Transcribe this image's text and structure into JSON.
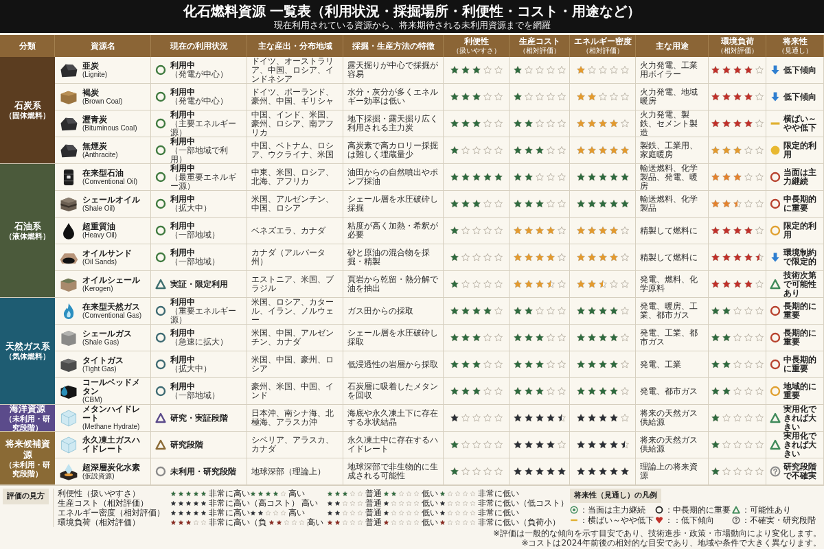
{
  "title": "化石燃料資源 一覧表（利用状況・採掘場所・利便性・コスト・用途など）",
  "subtitle": "現在利用されている資源から、将来期待される未利用資源までを網羅",
  "columns": [
    {
      "label": "分類"
    },
    {
      "label": "資源名"
    },
    {
      "label": "現在の利用状況"
    },
    {
      "label": "主な産出・分布地域"
    },
    {
      "label": "採掘・生産方法の特徴"
    },
    {
      "label": "利便性",
      "sub": "（扱いやすさ）"
    },
    {
      "label": "生産コスト",
      "sub": "（相対評価）"
    },
    {
      "label": "エネルギー密度",
      "sub": "（相対評価）"
    },
    {
      "label": "主な用途"
    },
    {
      "label": "環境負荷",
      "sub": "（相対評価）"
    },
    {
      "label": "将来性",
      "sub": "（見通し）"
    }
  ],
  "groups": [
    {
      "label": "石炭系",
      "sub": "（固体燃料）",
      "color": "#5b3d20",
      "rows": [
        {
          "name": "亜炭",
          "name_sub": "(Lignite)",
          "status": {
            "kind": "circle",
            "color": "#3f7a3f",
            "text": "利用中",
            "sub": "（発電が中心）"
          },
          "regions": "ドイツ、オーストラリア、中国、ロシア、インドネシア",
          "method": "露天掘りが中心で採掘が容易",
          "convenience": {
            "stars": 3,
            "color": "#2f6b3f"
          },
          "cost": {
            "stars": 1,
            "color": "#2f6b3f"
          },
          "density": {
            "stars": 1,
            "color": "#e39a2e"
          },
          "uses": "火力発電、工業用ボイラー",
          "environment": {
            "stars": 4,
            "color": "#c0302a"
          },
          "outlook": {
            "kind": "down",
            "color": "#2f7fd0",
            "text": "低下傾向"
          }
        },
        {
          "name": "褐炭",
          "name_sub": "(Brown Coal)",
          "status": {
            "kind": "circle",
            "color": "#3f7a3f",
            "text": "利用中",
            "sub": "（発電が中心）"
          },
          "regions": "ドイツ、ポーランド、豪州、中国、ギリシャ",
          "method": "水分・灰分が多くエネルギー効率は低い",
          "convenience": {
            "stars": 3,
            "color": "#2f6b3f"
          },
          "cost": {
            "stars": 1,
            "color": "#2f6b3f"
          },
          "density": {
            "stars": 2,
            "color": "#e39a2e"
          },
          "uses": "火力発電、地域暖房",
          "environment": {
            "stars": 4,
            "color": "#c0302a"
          },
          "outlook": {
            "kind": "down",
            "color": "#2f7fd0",
            "text": "低下傾向"
          }
        },
        {
          "name": "瀝青炭",
          "name_sub": "(Bituminous Coal)",
          "status": {
            "kind": "circle",
            "color": "#3f7a3f",
            "text": "利用中",
            "sub": "（主要エネルギー源）"
          },
          "regions": "中国、インド、米国、豪州、ロシア、南アフリカ",
          "method": "地下採掘・露天掘り広く利用される主力炭",
          "convenience": {
            "stars": 3,
            "color": "#2f6b3f"
          },
          "cost": {
            "stars": 2,
            "color": "#2f6b3f"
          },
          "density": {
            "stars": 4,
            "color": "#e39a2e"
          },
          "uses": "火力発電、製鉄、セメント製造",
          "environment": {
            "stars": 4,
            "color": "#c0302a"
          },
          "outlook": {
            "kind": "dash",
            "color": "#e0b030",
            "text": "横ばい～やや低下"
          }
        },
        {
          "name": "無煙炭",
          "name_sub": "(Anthracite)",
          "status": {
            "kind": "circle",
            "color": "#3f7a3f",
            "text": "利用中",
            "sub": "（一部地域で利用）"
          },
          "regions": "中国、ベトナム、ロシア、ウクライナ、米国",
          "method": "高炭素で高カロリー採掘は難しく埋蔵量少",
          "convenience": {
            "stars": 1,
            "color": "#2f6b3f"
          },
          "cost": {
            "stars": 3,
            "color": "#2f6b3f"
          },
          "density": {
            "stars": 5,
            "color": "#e39a2e"
          },
          "uses": "製鉄、工業用、家庭暖房",
          "environment": {
            "stars": 3,
            "color": "#e39a2e"
          },
          "outlook": {
            "kind": "dot",
            "color": "#e8b830",
            "text": "限定的利用"
          }
        }
      ]
    },
    {
      "label": "石油系",
      "sub": "（液体燃料）",
      "color": "#4b5a3b",
      "rows": [
        {
          "name": "在来型石油",
          "name_sub": "(Conventional Oil)",
          "status": {
            "kind": "circle",
            "color": "#3f7a3f",
            "text": "利用中",
            "sub": "（最重要エネルギー源）"
          },
          "regions": "中東、米国、ロシア、北海、アフリカ",
          "method": "油田からの自然噴出やポンプ採油",
          "convenience": {
            "stars": 5,
            "color": "#2f6b3f"
          },
          "cost": {
            "stars": 2,
            "color": "#2f6b3f"
          },
          "density": {
            "stars": 5,
            "color": "#2f6b3f"
          },
          "uses": "輸送燃料、化学製品、発電、暖房",
          "environment": {
            "stars": 3,
            "color": "#e3822e"
          },
          "outlook": {
            "kind": "circle",
            "color": "#b8432f",
            "text": "当面は主力継続"
          }
        },
        {
          "name": "シェールオイル",
          "name_sub": "(Shale Oil)",
          "status": {
            "kind": "circle",
            "color": "#3f7a3f",
            "text": "利用中",
            "sub": "（拡大中）"
          },
          "regions": "米国、アルゼンチン、中国、ロシア",
          "method": "シェール層を水圧破砕し採掘",
          "convenience": {
            "stars": 3,
            "color": "#2f6b3f"
          },
          "cost": {
            "stars": 3,
            "color": "#2f6b3f"
          },
          "density": {
            "stars": 5,
            "color": "#2f6b3f"
          },
          "uses": "輸送燃料、化学製品",
          "environment": {
            "stars": 2.5,
            "color": "#e3822e"
          },
          "outlook": {
            "kind": "circle",
            "color": "#b8432f",
            "text": "中長期的に重要"
          }
        },
        {
          "name": "超重質油",
          "name_sub": "(Heavy Oil)",
          "status": {
            "kind": "circle",
            "color": "#3f7a3f",
            "text": "利用中",
            "sub": "（一部地域）"
          },
          "regions": "ベネズエラ、カナダ",
          "method": "粘度が高く加熱・希釈が必要",
          "convenience": {
            "stars": 1,
            "color": "#2f6b3f"
          },
          "cost": {
            "stars": 4,
            "color": "#e39a2e"
          },
          "density": {
            "stars": 4,
            "color": "#e39a2e"
          },
          "uses": "精製して燃料に",
          "environment": {
            "stars": 4,
            "color": "#c0302a"
          },
          "outlook": {
            "kind": "circle",
            "color": "#e0a030",
            "text": "限定的利用"
          }
        },
        {
          "name": "オイルサンド",
          "name_sub": "(Oil Sands)",
          "status": {
            "kind": "circle",
            "color": "#3f7a3f",
            "text": "利用中",
            "sub": "（一部地域）"
          },
          "regions": "カナダ（アルバータ州）",
          "method": "砂と原油の混合物を採掘・精製",
          "convenience": {
            "stars": 1,
            "color": "#2f6b3f"
          },
          "cost": {
            "stars": 4,
            "color": "#e39a2e"
          },
          "density": {
            "stars": 4,
            "color": "#e39a2e"
          },
          "uses": "精製して燃料に",
          "environment": {
            "stars": 4.5,
            "color": "#c0302a"
          },
          "outlook": {
            "kind": "down",
            "color": "#2f7fd0",
            "text": "環境制約で限定的"
          }
        },
        {
          "name": "オイルシェール",
          "name_sub": "(Kerogen)",
          "status": {
            "kind": "triangle",
            "color": "#3f6f6f",
            "text": "実証・限定利用"
          },
          "regions": "エストニア、米国、ブラジル",
          "method": "頁岩から乾留・熱分解で油を抽出",
          "convenience": {
            "stars": 1,
            "color": "#2f6b3f"
          },
          "cost": {
            "stars": 3.5,
            "color": "#e39a2e"
          },
          "density": {
            "stars": 2.5,
            "color": "#e39a2e"
          },
          "uses": "発電、燃料、化学原料",
          "environment": {
            "stars": 4,
            "color": "#c0302a"
          },
          "outlook": {
            "kind": "triangle",
            "color": "#3f8a5a",
            "text": "技術次第で可能性あり"
          }
        }
      ]
    },
    {
      "label": "天然ガス系",
      "sub": "（気体燃料）",
      "color": "#1e5c72",
      "rows": [
        {
          "name": "在来型天然ガス",
          "name_sub": "(Conventional Gas)",
          "status": {
            "kind": "circle",
            "color": "#3d6a72",
            "text": "利用中",
            "sub": "（重要エネルギー源）"
          },
          "regions": "米国、ロシア、カタール、イラン、ノルウェー",
          "method": "ガス田からの採取",
          "convenience": {
            "stars": 4,
            "color": "#2f6b3f"
          },
          "cost": {
            "stars": 2,
            "color": "#2f6b3f"
          },
          "density": {
            "stars": 4,
            "color": "#2f6b3f"
          },
          "uses": "発電、暖房、工業、都市ガス",
          "environment": {
            "stars": 2,
            "color": "#2f6b3f"
          },
          "outlook": {
            "kind": "circle",
            "color": "#b8432f",
            "text": "長期的に重要"
          }
        },
        {
          "name": "シェールガス",
          "name_sub": "(Shale Gas)",
          "status": {
            "kind": "circle",
            "color": "#3d6a72",
            "text": "利用中",
            "sub": "（急速に拡大）"
          },
          "regions": "米国、中国、アルゼンチン、カナダ",
          "method": "シェール層を水圧破砕し採取",
          "convenience": {
            "stars": 3,
            "color": "#2f6b3f"
          },
          "cost": {
            "stars": 3,
            "color": "#2f6b3f"
          },
          "density": {
            "stars": 4,
            "color": "#2f6b3f"
          },
          "uses": "発電、工業、都市ガス",
          "environment": {
            "stars": 2,
            "color": "#2f6b3f"
          },
          "outlook": {
            "kind": "circle",
            "color": "#b8432f",
            "text": "長期的に重要"
          }
        },
        {
          "name": "タイトガス",
          "name_sub": "(Tight Gas)",
          "status": {
            "kind": "circle",
            "color": "#3d6a72",
            "text": "利用中",
            "sub": "（拡大中）"
          },
          "regions": "米国、中国、豪州、ロシア",
          "method": "低浸透性の岩層から採取",
          "convenience": {
            "stars": 3,
            "color": "#2f6b3f"
          },
          "cost": {
            "stars": 3,
            "color": "#2f6b3f"
          },
          "density": {
            "stars": 4,
            "color": "#2f6b3f"
          },
          "uses": "発電、工業",
          "environment": {
            "stars": 2,
            "color": "#2f6b3f"
          },
          "outlook": {
            "kind": "circle",
            "color": "#b8432f",
            "text": "中長期的に重要"
          }
        },
        {
          "name": "コールベッドメタン",
          "name_sub": "(CBM)",
          "status": {
            "kind": "circle",
            "color": "#3d6a72",
            "text": "利用中",
            "sub": "（一部地域）"
          },
          "regions": "豪州、米国、中国、インド",
          "method": "石炭層に吸着したメタンを回収",
          "convenience": {
            "stars": 3,
            "color": "#2f6b3f"
          },
          "cost": {
            "stars": 3,
            "color": "#2f6b3f"
          },
          "density": {
            "stars": 4,
            "color": "#2f6b3f"
          },
          "uses": "発電、都市ガス",
          "environment": {
            "stars": 2,
            "color": "#2f6b3f"
          },
          "outlook": {
            "kind": "circle",
            "color": "#e0a030",
            "text": "地域的に重要"
          }
        }
      ]
    },
    {
      "label": "海洋資源",
      "sub": "（未利用・研究段階）",
      "color": "#5b4b8b",
      "rows": [
        {
          "name": "メタンハイドレート",
          "name_sub": "(Methane Hydrate)",
          "status": {
            "kind": "triangle",
            "color": "#5a4a8a",
            "text": "研究・実証段階"
          },
          "regions": "日本沖、南シナ海、北極海、アラスカ沖",
          "method": "海底や永久凍土下に存在する氷状結晶",
          "convenience": {
            "stars": 1,
            "color": "#2b2f36"
          },
          "cost": {
            "stars": 4.5,
            "color": "#2b2f36"
          },
          "density": {
            "stars": 4,
            "color": "#2b2f36"
          },
          "uses": "将来の天然ガス供給源",
          "environment": {
            "stars": 1,
            "color": "#2f6b3f"
          },
          "outlook": {
            "kind": "triangle",
            "color": "#3f8a5a",
            "text": "実用化できれば大きい"
          }
        }
      ]
    },
    {
      "label": "将来候補資源",
      "sub": "（未利用・研究段階）",
      "color": "#8a6a35",
      "rows": [
        {
          "name": "永久凍土ガスハイドレート",
          "status": {
            "kind": "triangle",
            "color": "#8a6a35",
            "text": "研究段階"
          },
          "regions": "シベリア、アラスカ、カナダ",
          "method": "永久凍土中に存在するハイドレート",
          "convenience": {
            "stars": 1,
            "color": "#2f6b3f"
          },
          "cost": {
            "stars": 4,
            "color": "#2b2f36"
          },
          "density": {
            "stars": 4.5,
            "color": "#2b2f36"
          },
          "uses": "将来の天然ガス供給源",
          "environment": {
            "stars": 1,
            "color": "#2f6b3f"
          },
          "outlook": {
            "kind": "triangle",
            "color": "#3f8a5a",
            "text": "実用化できれば大きい"
          }
        },
        {
          "name": "超深層炭化水素",
          "name_sub": "(仮説資源)",
          "status": {
            "kind": "circle",
            "color": "#8a8a8a",
            "text": "未利用・研究段階"
          },
          "regions": "地球深部（理論上）",
          "method": "地球深部で非生物的に生成される可能性",
          "convenience": {
            "stars": 1,
            "color": "#2f6b3f"
          },
          "cost": {
            "stars": 5,
            "color": "#2b2f36"
          },
          "density": {
            "stars": 5,
            "color": "#2b2f36"
          },
          "uses": "理論上の将来資源",
          "environment": {
            "stars": 1,
            "color": "#2f6b3f"
          },
          "outlook": {
            "kind": "question",
            "color": "#8a8a8a",
            "text": "研究段階で不確実"
          }
        }
      ]
    }
  ],
  "rating_legend": {
    "title": "評価の見方",
    "rows": [
      {
        "label": "利便性（扱いやすさ）",
        "color": "#2f6b3f",
        "entries": [
          {
            "stars": 5,
            "text": "非常に高い"
          },
          {
            "stars": 4,
            "text": "高い"
          },
          {
            "stars": 3,
            "text": "普通"
          },
          {
            "stars": 2,
            "text": "低い"
          },
          {
            "stars": 1,
            "text": "非常に低い"
          }
        ]
      },
      {
        "label": "生産コスト（相対評価）",
        "color": "#2b2f36",
        "entries": [
          {
            "stars": 5,
            "text": "非常に高い"
          },
          {
            "note": "（高コスト）",
            "text": "高い"
          },
          {
            "stars": 2,
            "text": "普通"
          },
          {
            "stars": 1,
            "text": "低い"
          },
          {
            "stars": 1,
            "text": "非常に低い（低コスト）"
          }
        ]
      },
      {
        "label": "エネルギー密度（相対評価）",
        "color": "#2b2f36",
        "entries": [
          {
            "stars": 5,
            "text": "非常に高い"
          },
          {
            "stars": 2,
            "text": "高い"
          },
          {
            "stars": 2,
            "text": "普通"
          },
          {
            "stars": 1,
            "text": "低い"
          },
          {
            "stars": 1,
            "text": "非常に低い"
          }
        ]
      },
      {
        "label": "環境負荷（相対評価）",
        "color": "#8a2a22",
        "entries": [
          {
            "stars": 3,
            "text": "非常に高い"
          },
          {
            "note": "（負",
            "stars": 2,
            "text": "高い"
          },
          {
            "stars": 2,
            "text": "普通"
          },
          {
            "stars": 1,
            "text": "低い"
          },
          {
            "stars": 1,
            "text": "非常に低い（負荷小）"
          }
        ]
      }
    ]
  },
  "outlook_legend": {
    "title": "将来性（見通し）の凡例",
    "items": [
      {
        "kind": "double-circle",
        "color": "#3f8a5a",
        "text": "：当面は主力継続"
      },
      {
        "kind": "circle",
        "color": "#222222",
        "text": "：中長期的に重要"
      },
      {
        "kind": "triangle",
        "color": "#3f8a5a",
        "text": "：可能性あり"
      },
      {
        "kind": "dash",
        "color": "#e0b030",
        "text": "：横ばい～やや低下"
      },
      {
        "kind": "heart",
        "color": "#c0302a",
        "text": "：：低下傾向"
      },
      {
        "kind": "question",
        "color": "#666666",
        "text": "：不確実・研究段階"
      }
    ],
    "notes": [
      "※評価は一般的な傾向を示す目安であり、技術進歩・政策・市場動向により変化します。",
      "※コストは2024年前後の相対的な目安であり、地域や条件で大きく異なります。"
    ]
  }
}
